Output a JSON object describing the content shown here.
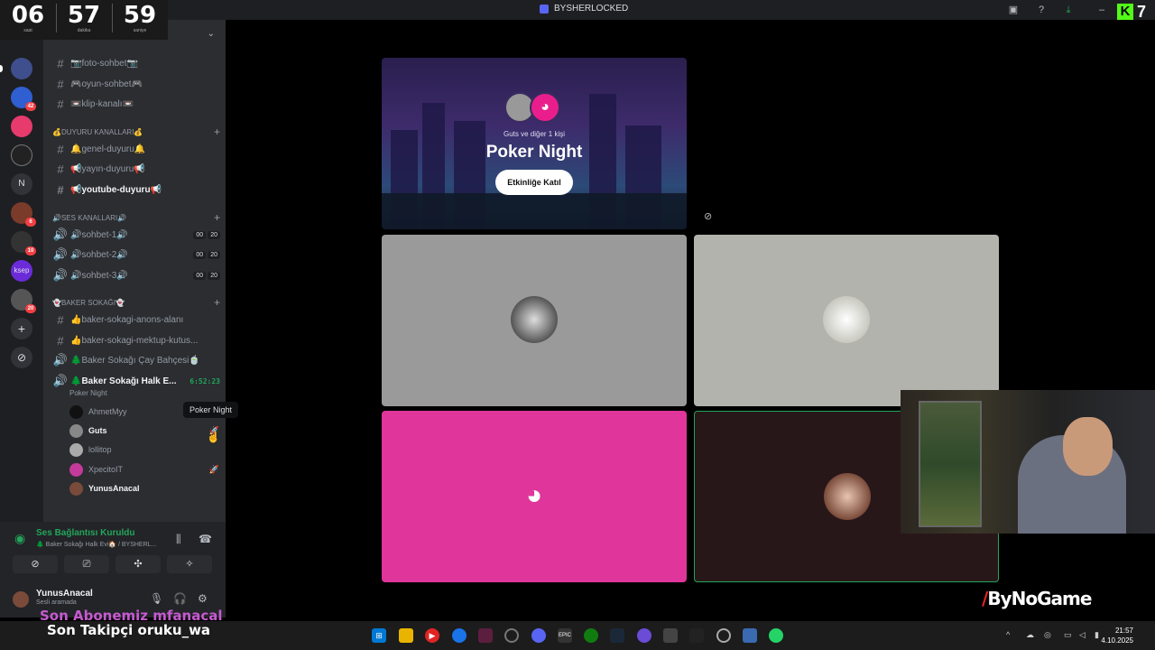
{
  "timer": {
    "hours": "06",
    "minutes": "57",
    "seconds": "59",
    "hours_label": "saat",
    "minutes_label": "dakika",
    "seconds_label": "saniye"
  },
  "window": {
    "title": "BYSHERLOCKED"
  },
  "kick_counter": "7",
  "servers": [
    {
      "label": "",
      "badge": ""
    },
    {
      "label": "",
      "badge": "42"
    },
    {
      "label": "",
      "badge": ""
    },
    {
      "label": "",
      "badge": ""
    },
    {
      "label": "N",
      "badge": ""
    },
    {
      "label": "",
      "badge": "6"
    },
    {
      "label": "",
      "badge": "10"
    },
    {
      "label": "ksep",
      "badge": ""
    },
    {
      "label": "",
      "badge": "20"
    }
  ],
  "channels": {
    "text_top": [
      "📷foto-sohbet📷",
      "🎮oyun-sohbet🎮",
      "📼klip-kanalı📼"
    ],
    "cat_announce": "💰DUYURU KANALLARI💰",
    "announce": [
      "🔔genel-duyuru🔔",
      "📢yayın-duyuru📢",
      "📢youtube-duyuru📢"
    ],
    "cat_voice": "🔊SES KANALLARI🔊",
    "voice": [
      {
        "name": "🔊sohbet-1🔊",
        "a": "00",
        "b": "20"
      },
      {
        "name": "🔊sohbet-2🔊",
        "a": "00",
        "b": "20"
      },
      {
        "name": "🔊sohbet-3🔊",
        "a": "00",
        "b": "20"
      }
    ],
    "cat_baker": "👻BAKER SOKAĞI👻",
    "baker": [
      "👍baker-sokagi-anons-alanı",
      "👍baker-sokagi-mektup-kutus...",
      "🌲Baker Sokağı Çay Bahçesi🍵"
    ],
    "active_voice": {
      "name": "🌲Baker Sokağı Halk E...",
      "time": "6:52:23",
      "activity": "Poker Night"
    },
    "members": [
      "AhmetMyy",
      "Guts",
      "lollitop",
      "XpecitoIT",
      "YunusAnacal"
    ]
  },
  "tooltip": "Poker Night",
  "voice_panel": {
    "status": "Ses Bağlantısı Kuruldu",
    "where": "🌲 Baker Sokağı Halk Evi🏠 / BYSHERL...",
    "user_name": "YunusAnacal",
    "user_status": "Sesli aramada"
  },
  "overlay": {
    "sub": "Son Abonemiz mfanacal",
    "follower": "Son Takipçi oruku_wa"
  },
  "event": {
    "who": "Guts ve diğer 1 kişi",
    "title": "Poker Night",
    "join_button": "Etkinliğe Katıl"
  },
  "brand_logo": "ByNoGame",
  "clock": {
    "time": "21:57",
    "date": "4.10.2025"
  },
  "colors": {
    "accent": "#5865f2",
    "online": "#23a55a",
    "pink_tile": "#e0359a",
    "kick": "#53fc18"
  }
}
